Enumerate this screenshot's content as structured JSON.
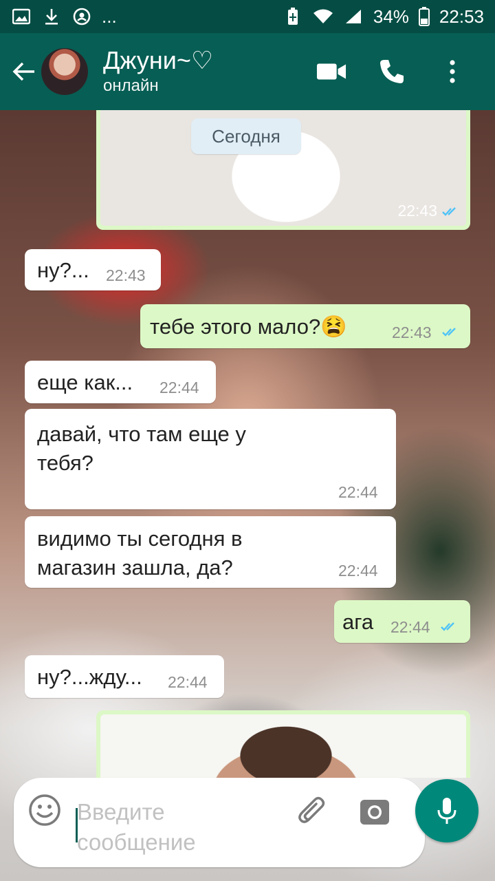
{
  "status_bar": {
    "left_icons": [
      "image-icon",
      "download-icon",
      "whatsapp-icon",
      "more-dots"
    ],
    "more": "...",
    "battery": "34%",
    "time": "22:53"
  },
  "header": {
    "contact_name": "Джуни~♡",
    "contact_status": "онлайн"
  },
  "chat": {
    "date_chip": "Сегодня",
    "messages": [
      {
        "direction": "out",
        "type": "image",
        "time": "22:43"
      },
      {
        "direction": "in",
        "text": "ну?...",
        "time": "22:43"
      },
      {
        "direction": "out",
        "text": "тебе этого мало?😫",
        "time": "22:43"
      },
      {
        "direction": "in",
        "text": "еще как...",
        "time": "22:44"
      },
      {
        "direction": "in",
        "text": "давай, что там еще у тебя?",
        "time": "22:44"
      },
      {
        "direction": "in",
        "text": "видимо ты сегодня в магазин зашла, да?",
        "time": "22:44"
      },
      {
        "direction": "out",
        "text": "ага",
        "time": "22:44"
      },
      {
        "direction": "in",
        "text": "ну?...жду...",
        "time": "22:44"
      },
      {
        "direction": "out",
        "type": "image"
      }
    ]
  },
  "input": {
    "placeholder": "Введите сообщение"
  },
  "colors": {
    "header": "#075e54",
    "status_bar": "#054d44",
    "outgoing": "#dcf8c6",
    "incoming": "#ffffff",
    "fab": "#00897b",
    "tick_read": "#4fc3f7"
  }
}
